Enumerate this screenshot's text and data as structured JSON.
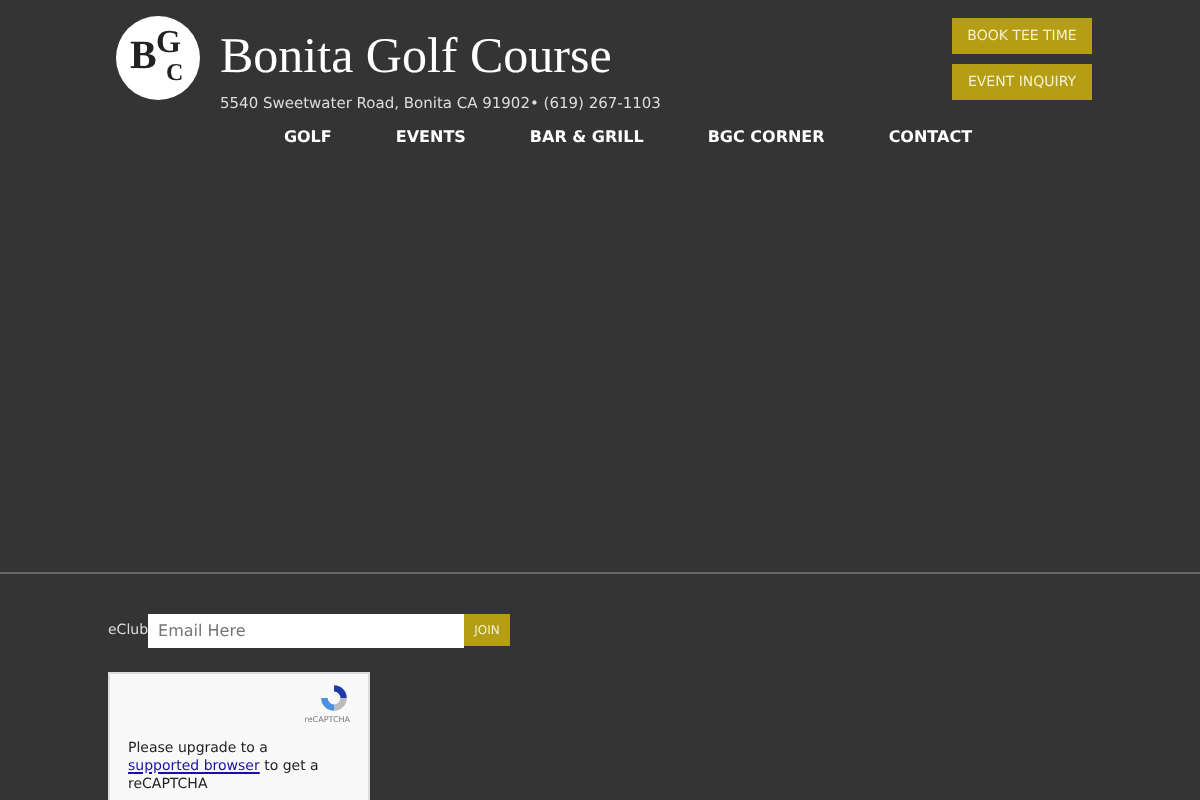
{
  "header": {
    "logo_text": "BGC",
    "title": "Bonita Golf Course",
    "address": "5540 Sweetwater Road, Bonita CA 91902• (619) 267-1103"
  },
  "actions": [
    "BOOK TEE TIME",
    "EVENT INQUIRY"
  ],
  "nav": [
    "GOLF",
    "EVENTS",
    "BAR & GRILL",
    "BGC CORNER",
    "CONTACT"
  ],
  "eclub": {
    "label": "eClub",
    "placeholder": "Email Here",
    "button": "JOIN"
  },
  "recaptcha": {
    "logo_label": "reCAPTCHA",
    "message_before": "Please upgrade to a ",
    "link": "supported browser",
    "message_after": " to get a reCAPTCHA"
  }
}
